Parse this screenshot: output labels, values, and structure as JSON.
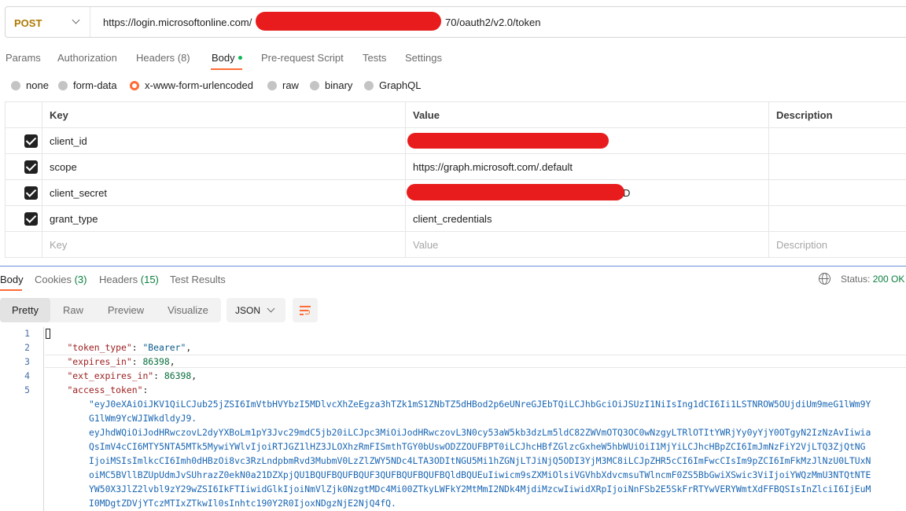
{
  "request": {
    "method": "POST",
    "url_prefix": "https://login.microsoftonline.com/",
    "url_suffix": "70/oauth2/v2.0/token"
  },
  "request_tabs": {
    "params": "Params",
    "authorization": "Authorization",
    "headers": "Headers (8)",
    "body": "Body",
    "prerequest": "Pre-request Script",
    "tests": "Tests",
    "settings": "Settings"
  },
  "body_types": {
    "none": "none",
    "form_data": "form-data",
    "urlencoded": "x-www-form-urlencoded",
    "raw": "raw",
    "binary": "binary",
    "graphql": "GraphQL",
    "selected": "x-www-form-urlencoded"
  },
  "params_table": {
    "headers": {
      "key": "Key",
      "value": "Value",
      "description": "Description"
    },
    "rows": [
      {
        "key": "client_id",
        "value": "",
        "checked": true
      },
      {
        "key": "scope",
        "value": "https://graph.microsoft.com/.default",
        "checked": true
      },
      {
        "key": "client_secret",
        "value": "D",
        "checked": true
      },
      {
        "key": "grant_type",
        "value": "client_credentials",
        "checked": true
      }
    ],
    "placeholder": {
      "key": "Key",
      "value": "Value",
      "description": "Description"
    }
  },
  "response": {
    "tabs": {
      "body": "Body",
      "cookies": "Cookies",
      "cookies_count": "(3)",
      "headers": "Headers",
      "headers_count": "(15)",
      "test_results": "Test Results"
    },
    "status_label": "Status:",
    "status_value": "200 OK",
    "views": {
      "pretty": "Pretty",
      "raw": "Raw",
      "preview": "Preview",
      "visualize": "Visualize"
    },
    "format": "JSON",
    "line_numbers": [
      "1",
      "2",
      "3",
      "4",
      "5"
    ],
    "json": {
      "token_type_key": "\"token_type\"",
      "token_type_val": "\"Bearer\"",
      "expires_in_key": "\"expires_in\"",
      "expires_in_val": "86398",
      "ext_expires_in_key": "\"ext_expires_in\"",
      "ext_expires_in_val": "86398",
      "access_token_key": "\"access_token\""
    },
    "token_lines": [
      "\"eyJ0eXAiOiJKV1QiLCJub25jZSI6ImVtbHVYbzI5MDlvcXhZeEgza3hTZk1mS1ZNbTZ5dHBod2p6eUNreGJEbTQiLCJhbGciOiJSUzI1NiIsIng1dCI6Ii1LSTNROW5OUjdiUm9meG1lWm9Y",
      "G1lWm9YcWJIWkdldyJ9.",
      "eyJhdWQiOiJodHRwczovL2dyYXBoLm1pY3Jvc29mdC5jb20iLCJpc3MiOiJodHRwczovL3N0cy53aW5kb3dzLm5ldC82ZWVmOTQ3OC0wNzgyLTRlOTItYWRjYy0yYjY0OTgyN2IzNzAvIiwia",
      "QsImV4cCI6MTY5NTA5MTk5MywiYWlvIjoiRTJGZ1lHZ3JLOXhzRmFISmthTGY0bUswODZZOUFBPT0iLCJhcHBfZGlzcGxheW5hbWUiOiI1MjYiLCJhcHBpZCI6ImJmNzFiY2VjLTQ3ZjQtNG",
      "IjoiMSIsImlkcCI6Imh0dHBzOi8vc3RzLndpbmRvd3MubmV0LzZlZWY5NDc4LTA3ODItNGU5Mi1hZGNjLTJiNjQ5ODI3YjM3MC8iLCJpZHR5cCI6ImFwcCIsIm9pZCI6ImFkMzJlNzU0LTUxN",
      "oiMC5BVllBZUpUdmJvSUhrazZ0ekN0a21DZXpjQU1BQUFBQUFBQUF3QUFBQUFBQUFBQldBQUEuIiwicm9sZXMiOlsiVGVhbXdvcmsuTWlncmF0ZS5BbGwiXSwic3ViIjoiYWQzMmU3NTQtNTE",
      "YW50X3JlZ2lvbl9zY29wZSI6IkFTIiwidGlkIjoiNmVlZjk0NzgtMDc4Mi00ZTkyLWFkY2MtMmI2NDk4MjdiMzcwIiwidXRpIjoiNnFSb2E5SkFrRTYwVERYWmtXdFFBQSIsInZlciI6IjEuM",
      "I0MDgtZDVjYTczMTIxZTkwIl0sInhtc190Y2R0IjoxNDgzNjE2NjQ4fQ."
    ]
  }
}
